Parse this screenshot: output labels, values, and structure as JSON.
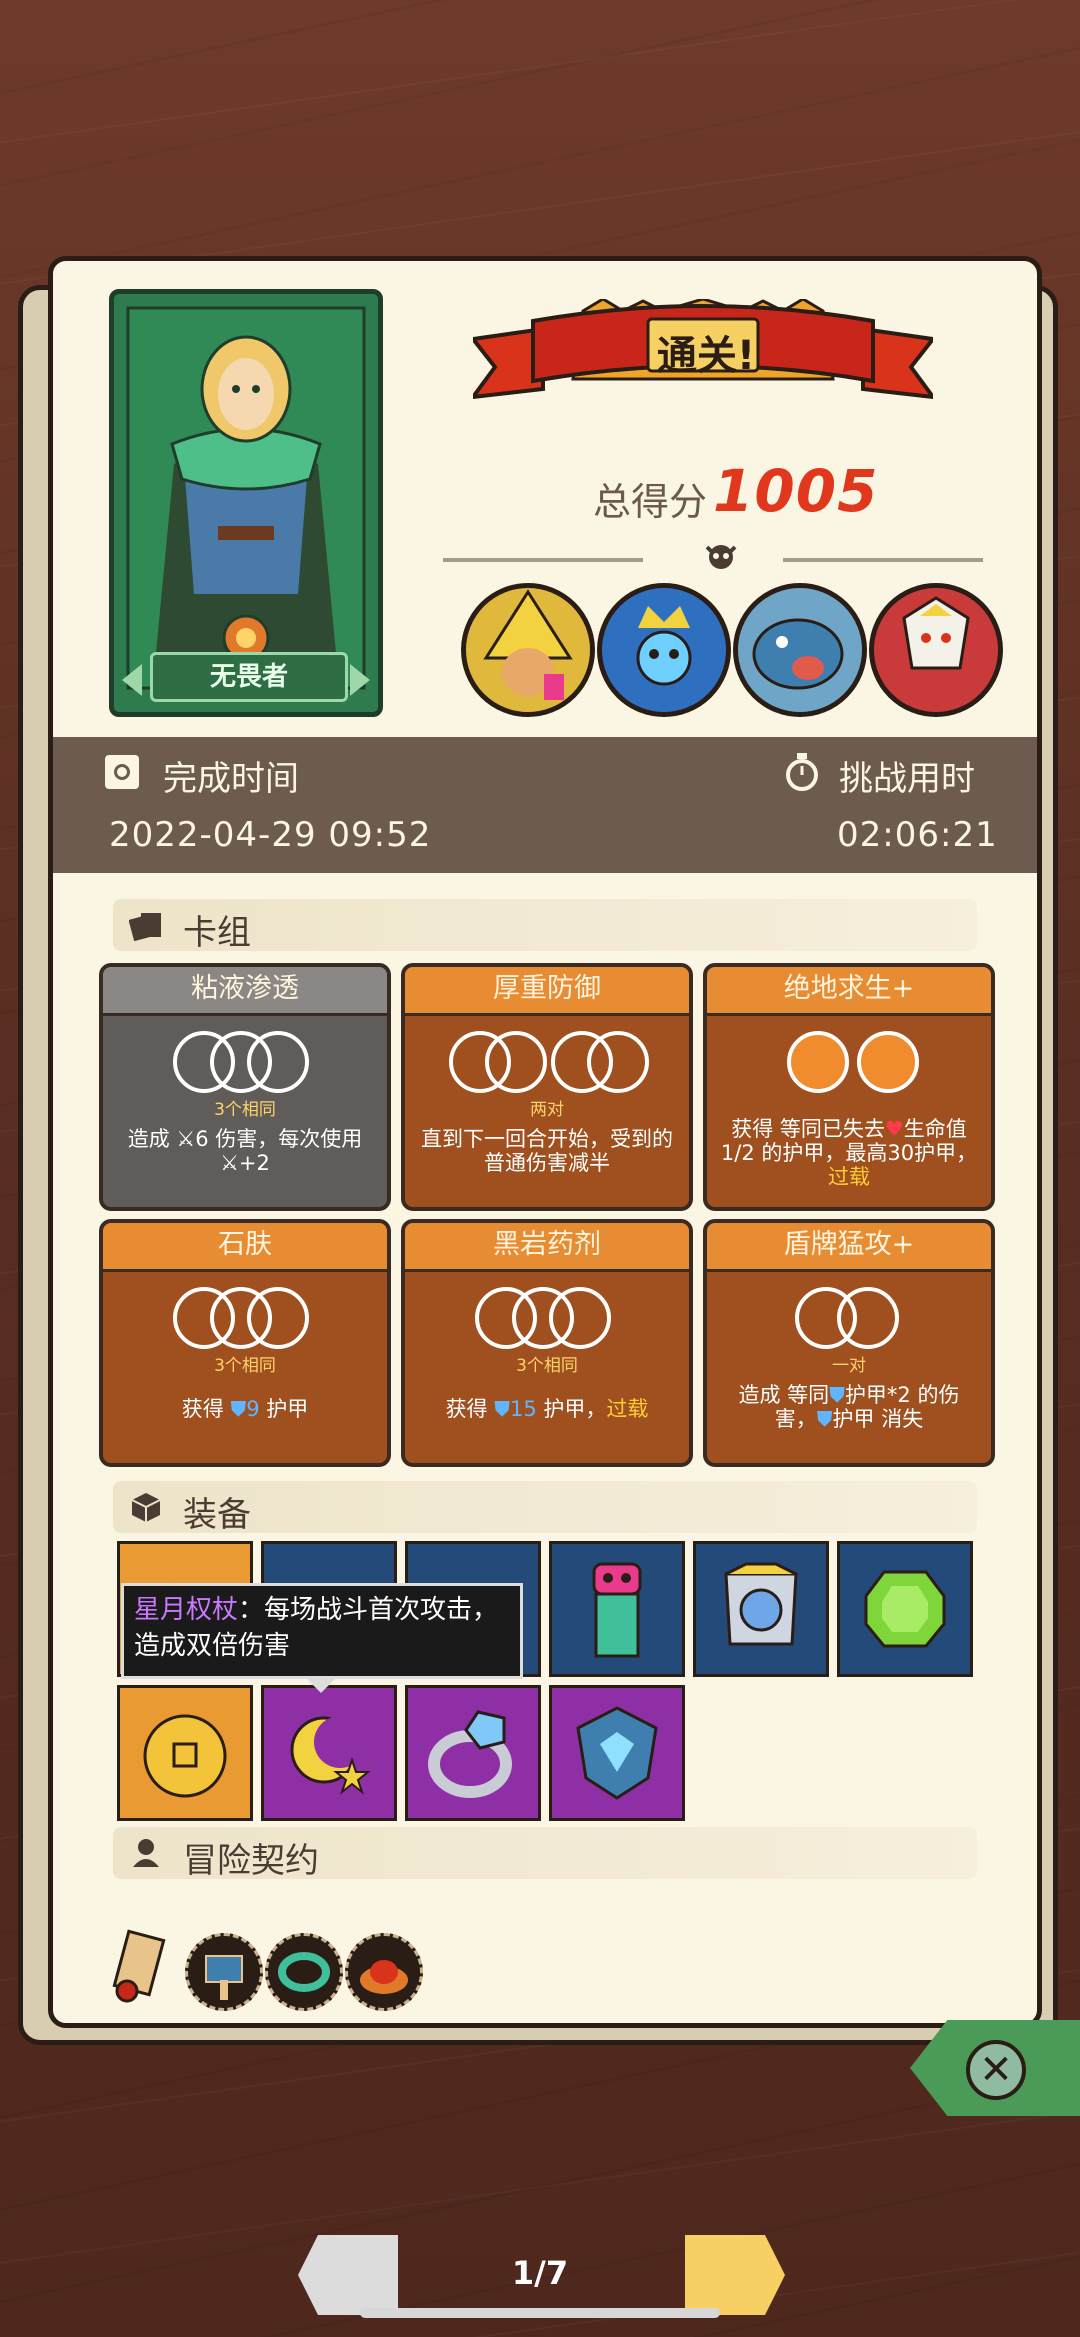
{
  "hero": {
    "name": "无畏者"
  },
  "result": {
    "banner": "通关!",
    "score_label": "总得分",
    "score_value": "1005"
  },
  "bosses": [
    "yellow-hat-wizard-portrait",
    "blue-crowned-idol-portrait",
    "blue-fish-monster-portrait",
    "white-armored-demon-portrait"
  ],
  "times": {
    "complete_label": "完成时间",
    "complete_value": "2022-04-29 09:52",
    "challenge_label": "挑战用时",
    "challenge_value": "02:06:21"
  },
  "sections": {
    "deck": "卡组",
    "equipment": "装备",
    "contract": "冒险契约"
  },
  "cards": [
    {
      "name": "粘液渗透",
      "sub": "3个相同",
      "desc": "造成 ⚔6 伤害，每次使用 ⚔+2"
    },
    {
      "name": "厚重防御",
      "sub": "两对",
      "desc": "直到下一回合开始，受到的普通伤害减半"
    },
    {
      "name": "绝地求生+",
      "sub": "",
      "desc_a": "获得 等同已失去",
      "desc_b": "生命值 1/2 的护甲，最高30护甲，",
      "desc_hl": "过载"
    },
    {
      "name": "石肤",
      "sub": "3个相同",
      "desc_a": "获得",
      "shield_val": "9",
      "desc_b": "护甲"
    },
    {
      "name": "黑岩药剂",
      "sub": "3个相同",
      "desc_a": "获得",
      "shield_val": "15",
      "desc_b": "护甲，",
      "desc_hl": "过载"
    },
    {
      "name": "盾牌猛攻+",
      "sub": "一对",
      "desc_a": "造成 等同",
      "desc_b": "护甲*2 的伤害，",
      "desc_c": "护甲 消失"
    }
  ],
  "tooltip": {
    "name": "星月权杖",
    "text": "：每场战斗首次攻击，造成双倍伤害"
  },
  "pager": {
    "label": "1/7"
  },
  "colors": {
    "accent_red": "#e0371d",
    "panel": "#fbf5e3",
    "card_orange": "#e88c34",
    "card_brown": "#a0501f"
  }
}
